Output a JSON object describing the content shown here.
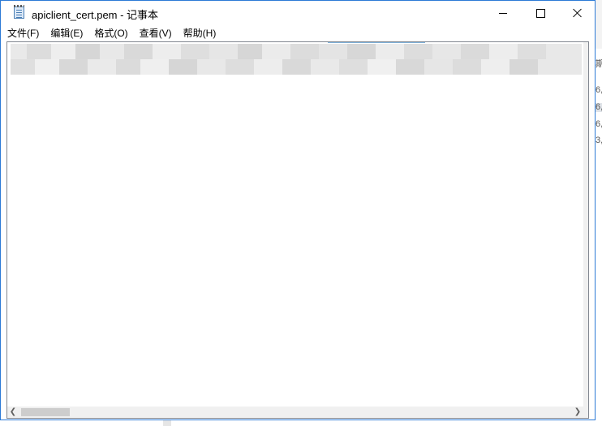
{
  "window": {
    "title": "apiclient_cert.pem - 记事本"
  },
  "menu": {
    "items": [
      {
        "label": "文件(F)"
      },
      {
        "label": "编辑(E)"
      },
      {
        "label": "格式(O)"
      },
      {
        "label": "查看(V)"
      },
      {
        "label": "帮助(H)"
      }
    ]
  },
  "editor": {
    "content": ""
  },
  "background_peek": {
    "right_labels": [
      "期",
      "6,",
      "6,",
      "6,",
      "3,"
    ]
  },
  "colors": {
    "window_border": "#2c7ad6",
    "scrollbar_track": "#f0f0f0",
    "scrollbar_thumb": "#cdcdcd"
  }
}
